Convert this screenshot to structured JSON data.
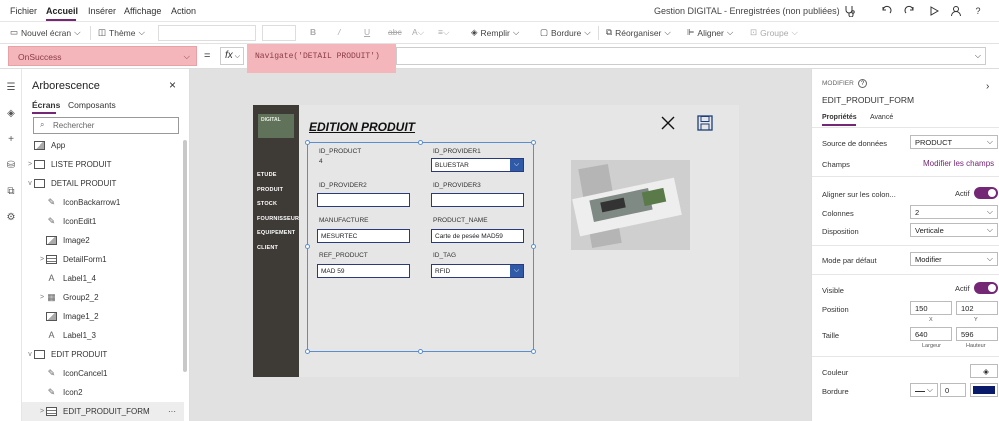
{
  "menu": {
    "items": [
      "Fichier",
      "Accueil",
      "Insérer",
      "Affichage",
      "Action"
    ],
    "active": "Accueil",
    "app_title": "Gestion DIGITAL - Enregistrées (non publiées)"
  },
  "toolbar": {
    "new_screen": "Nouvel écran",
    "theme": "Thème",
    "fill": "Remplir",
    "border": "Bordure",
    "reorder": "Réorganiser",
    "align": "Aligner",
    "group": "Groupe",
    "bold": "B",
    "italic": "/",
    "underline": "U",
    "strike": "abc"
  },
  "formula": {
    "property": "OnSuccess",
    "equals": "=",
    "fx": "fx",
    "text": "Navigate('DETAIL PRODUIT')"
  },
  "tree": {
    "title": "Arborescence",
    "tabs": [
      "Écrans",
      "Composants"
    ],
    "active_tab": "Écrans",
    "search_placeholder": "Rechercher",
    "nodes": [
      {
        "label": "App",
        "type": "app",
        "level": 0,
        "chevron": ""
      },
      {
        "label": "LISTE PRODUIT",
        "type": "screen",
        "level": 0,
        "chevron": ">"
      },
      {
        "label": "DETAIL PRODUIT",
        "type": "screen",
        "level": 0,
        "chevron": "v"
      },
      {
        "label": "IconBackarrow1",
        "type": "ctrl",
        "level": 1,
        "chevron": ""
      },
      {
        "label": "IconEdit1",
        "type": "ctrl",
        "level": 1,
        "chevron": ""
      },
      {
        "label": "Image2",
        "type": "img",
        "level": 1,
        "chevron": ""
      },
      {
        "label": "DetailForm1",
        "type": "form",
        "level": 1,
        "chevron": ">"
      },
      {
        "label": "Label1_4",
        "type": "label",
        "level": 1,
        "chevron": ""
      },
      {
        "label": "Group2_2",
        "type": "group",
        "level": 1,
        "chevron": ">"
      },
      {
        "label": "Image1_2",
        "type": "img",
        "level": 1,
        "chevron": ""
      },
      {
        "label": "Label1_3",
        "type": "label",
        "level": 1,
        "chevron": ""
      },
      {
        "label": "EDIT PRODUIT",
        "type": "screen",
        "level": 0,
        "chevron": "v"
      },
      {
        "label": "IconCancel1",
        "type": "ctrl",
        "level": 1,
        "chevron": ""
      },
      {
        "label": "Icon2",
        "type": "ctrl",
        "level": 1,
        "chevron": ""
      },
      {
        "label": "EDIT_PRODUIT_FORM",
        "type": "form",
        "level": 1,
        "chevron": ">",
        "selected": true,
        "more": "···"
      }
    ]
  },
  "canvas": {
    "title": "EDITION PRODUIT",
    "logo_text": "DIGITAL",
    "nav": [
      "ETUDE",
      "PRODUIT",
      "STOCK",
      "FOURNISSEUR",
      "EQUIPEMENT",
      "CLIENT"
    ],
    "fields": {
      "id_product": {
        "label": "ID_PRODUCT",
        "value": "4"
      },
      "id_provider1": {
        "label": "ID_PROVIDER1",
        "value": "BLUESTAR"
      },
      "id_provider2": {
        "label": "ID_PROVIDER2",
        "value": ""
      },
      "id_provider3": {
        "label": "ID_PROVIDER3",
        "value": ""
      },
      "manufacture": {
        "label": "MANUFACTURE",
        "value": "MESURTEC"
      },
      "product_name": {
        "label": "PRODUCT_NAME",
        "value": "Carte de pesée  MAD59"
      },
      "ref_product": {
        "label": "REF_PRODUCT",
        "value": "MAD 59"
      },
      "id_tag": {
        "label": "ID_TAG",
        "value": "RFID"
      }
    }
  },
  "props": {
    "section": "MODIFIER",
    "control_name": "EDIT_PRODUIT_FORM",
    "tabs": [
      "Propriétés",
      "Avancé"
    ],
    "active_tab": "Propriétés",
    "datasource_label": "Source de données",
    "datasource": "PRODUCT",
    "fields_label": "Champs",
    "fields_link": "Modifier les champs",
    "snap_label": "Aligner sur les colon...",
    "snap_state": "Actif",
    "columns_label": "Colonnes",
    "columns": "2",
    "layout_label": "Disposition",
    "layout": "Verticale",
    "mode_label": "Mode par défaut",
    "mode": "Modifier",
    "visible_label": "Visible",
    "visible_state": "Actif",
    "position_label": "Position",
    "pos_x": "150",
    "pos_y": "102",
    "x_label": "X",
    "y_label": "Y",
    "size_label": "Taille",
    "width": "640",
    "height": "596",
    "w_label": "Largeur",
    "h_label": "Hauteur",
    "color_label": "Couleur",
    "border_label": "Bordure",
    "border_width": "0",
    "colors": {
      "accent": "#742774",
      "border_swatch": "#0a1a6b"
    }
  }
}
